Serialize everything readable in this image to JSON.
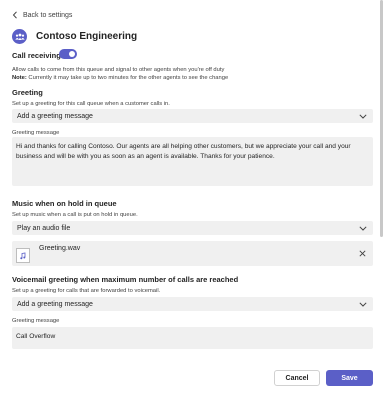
{
  "back": {
    "label": "Back to settings"
  },
  "header": {
    "title": "Contoso Engineering",
    "icon": "people-team-icon"
  },
  "call_receiving": {
    "label": "Call receiving",
    "enabled": true,
    "description": "Allow calls to come from this queue and signal to other agents when you're off duty",
    "note_label": "Note:",
    "note_text": " Currently it may take up to two minutes for the other agents to see the change"
  },
  "greeting": {
    "title": "Greeting",
    "description": "Set up a greeting for this call queue when a customer calls in.",
    "dropdown_value": "Add a greeting message",
    "message_label": "Greeting message",
    "message": "Hi and thanks for calling Contoso. Our agents are all helping other customers, but we appreciate your call and your business and will be with you as soon as an agent is available. Thanks for your patience."
  },
  "music_on_hold": {
    "title": "Music when on hold in queue",
    "description": "Set up music when a call is put on hold in queue.",
    "dropdown_value": "Play an audio file",
    "file_name": "Greeting.wav"
  },
  "voicemail": {
    "title": "Voicemail greeting when maximum number of calls are reached",
    "description": "Set up a greeting for calls that are forwarded to voicemail.",
    "dropdown_value": "Add a greeting message",
    "message_label": "Greeting message",
    "message": "Call Overflow"
  },
  "actions": {
    "cancel_label": "Cancel",
    "save_label": "Save"
  },
  "colors": {
    "accent": "#5b5fc7",
    "field_bg": "#f0f0f0",
    "text": "#242424"
  }
}
